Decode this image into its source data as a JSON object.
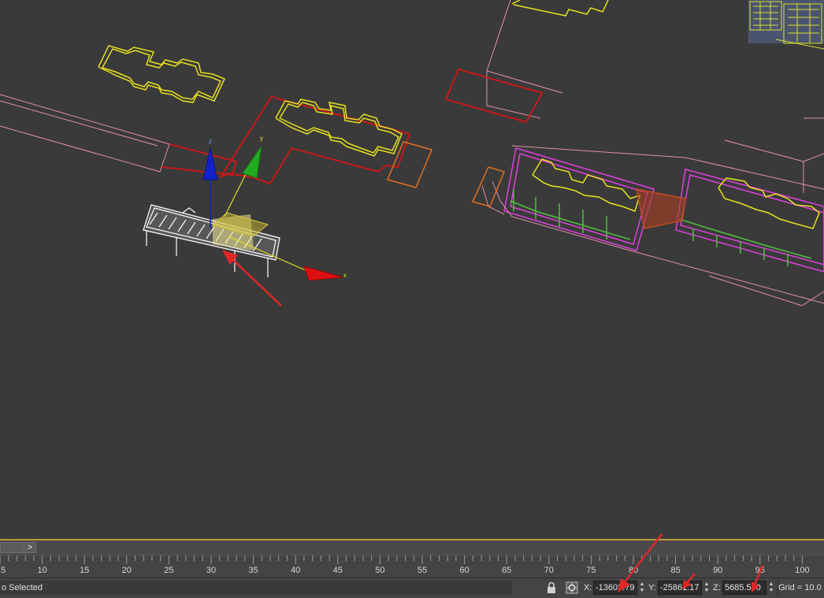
{
  "viewport": {
    "axis_labels": {
      "x": "x",
      "y": "y",
      "z": "z"
    },
    "colors": {
      "background": "#3a3a3a",
      "yellow_wire": "#e8e020",
      "red_wire": "#c81818",
      "orange_wire": "#e07020",
      "pink_wire": "#e090b0",
      "magenta_wire": "#e040e0",
      "green_wire": "#50c040",
      "selected_object": "#ffffff",
      "axis_x": "#dd1111",
      "axis_y": "#22aa22",
      "axis_z": "#1122cc",
      "annotation_arrow": "#e02828"
    }
  },
  "time_slider": {
    "next_label": ">"
  },
  "track_bar": {
    "ticks": [
      "5",
      "10",
      "15",
      "20",
      "25",
      "30",
      "35",
      "40",
      "45",
      "50",
      "55",
      "60",
      "65",
      "70",
      "75",
      "80",
      "85",
      "90",
      "95",
      "100"
    ]
  },
  "status_bar": {
    "selection_text": "o Selected",
    "x_label": "X:",
    "x_value": "-13603.79",
    "y_label": "Y:",
    "y_value": "-25861.17",
    "z_label": "Z:",
    "z_value": "5685.500",
    "grid_text": "Grid = 10.0",
    "icons": [
      "lock-icon",
      "absolute-mode-icon"
    ]
  }
}
